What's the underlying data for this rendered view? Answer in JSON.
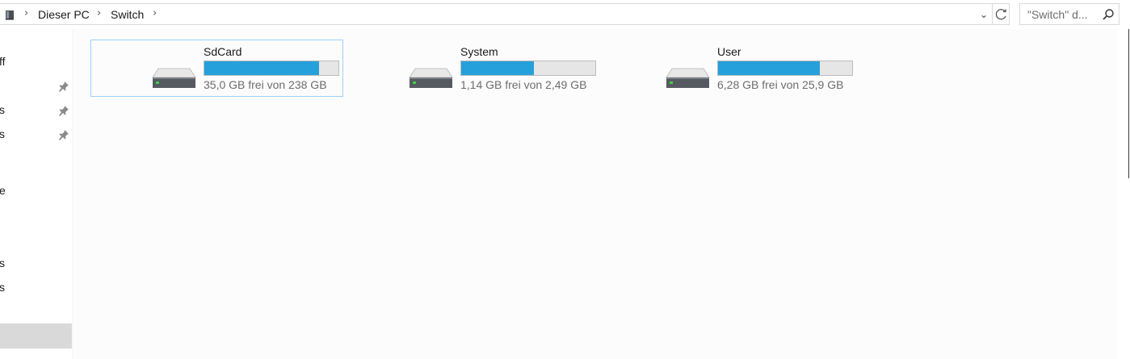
{
  "address_bar": {
    "location_icon": "this-pc-icon",
    "breadcrumbs": [
      "Dieser PC",
      "Switch"
    ],
    "dropdown_icon": "chevron-down-icon",
    "refresh_icon": "refresh-icon"
  },
  "search": {
    "placeholder": "\"Switch\" d...",
    "icon": "search-icon"
  },
  "navigation": {
    "items": [
      {
        "label": "ff",
        "pinned": false
      },
      {
        "label": "",
        "pinned": true
      },
      {
        "label": "s",
        "pinned": true
      },
      {
        "label": "s",
        "pinned": true
      },
      {
        "label": "e",
        "pinned": false
      },
      {
        "label": "s",
        "pinned": false
      },
      {
        "label": "s",
        "pinned": false
      }
    ]
  },
  "drives": [
    {
      "name": "SdCard",
      "free_text": "35,0 GB frei von 238 GB",
      "used_fraction": 0.853,
      "selected": true,
      "icon": "hard-drive-icon"
    },
    {
      "name": "System",
      "free_text": "1,14 GB frei von 2,49 GB",
      "used_fraction": 0.542,
      "selected": false,
      "icon": "hard-drive-icon"
    },
    {
      "name": "User",
      "free_text": "6,28 GB frei von 25,9 GB",
      "used_fraction": 0.758,
      "selected": false,
      "icon": "hard-drive-icon"
    }
  ],
  "colors": {
    "usage_bar": "#26a0da",
    "selection_border": "#99d1ff"
  }
}
